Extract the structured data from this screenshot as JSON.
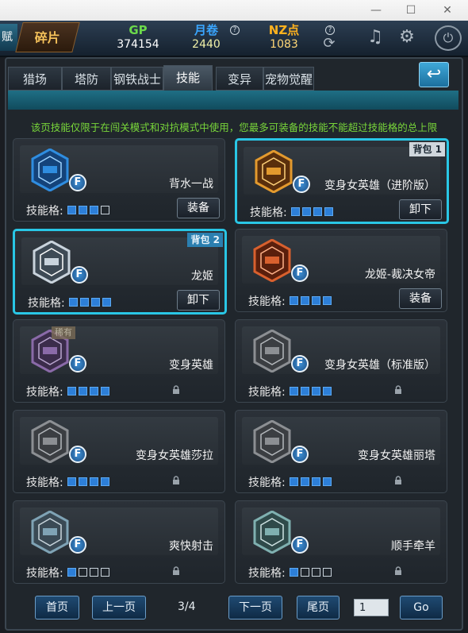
{
  "window": {
    "minimize": "—",
    "maximize": "☐",
    "close": "✕"
  },
  "topbar": {
    "left_cap": "赋",
    "fragments_tab": "碎片",
    "gp": {
      "label": "GP",
      "value": "374154"
    },
    "yuejuan": {
      "label": "月卷",
      "value": "2440"
    },
    "nz": {
      "label": "NZ点",
      "value": "1083"
    },
    "colors": {
      "gp": "#6bd94b",
      "yuejuan": "#3aa6ff",
      "nz": "#ffb21e"
    }
  },
  "tabs": [
    {
      "label": "猎场"
    },
    {
      "label": "塔防"
    },
    {
      "label": "钢铁战士"
    },
    {
      "label": "技能",
      "active": true
    },
    {
      "label": "变异"
    },
    {
      "label": "宠物觉醒"
    }
  ],
  "notice": "该页技能仅限于在闯关模式和对抗模式中使用，您最多可装备的技能不能超过技能格的总上限",
  "slot_label": "技能格:",
  "skills": [
    {
      "name": "背水一战",
      "badge": "F",
      "slots_total": 4,
      "slots_filled": 3,
      "action": "装备",
      "selected": false,
      "bag_tag": "",
      "locked": false,
      "icon": "shield-blue-icon"
    },
    {
      "name": "变身女英雄（进阶版）",
      "badge": "F",
      "slots_total": 4,
      "slots_filled": 4,
      "action": "卸下",
      "selected": true,
      "bag_tag": "背包 1",
      "locked": false,
      "icon": "hero-gold-icon"
    },
    {
      "name": "龙姬",
      "badge": "F",
      "slots_total": 4,
      "slots_filled": 4,
      "action": "卸下",
      "selected": true,
      "bag_tag": "背包 2",
      "locked": false,
      "icon": "hero-silver-icon"
    },
    {
      "name": "龙姬-裁决女帝",
      "badge": "F",
      "slots_total": 4,
      "slots_filled": 4,
      "action": "装备",
      "selected": false,
      "bag_tag": "",
      "locked": false,
      "icon": "hero-red-icon"
    },
    {
      "name": "变身英雄",
      "badge": "F",
      "slots_total": 4,
      "slots_filled": 4,
      "action": "",
      "selected": false,
      "bag_tag": "",
      "locked": true,
      "icon": "hero-purple-icon",
      "rare_tag": "稀有"
    },
    {
      "name": "变身女英雄（标准版）",
      "badge": "F",
      "slots_total": 4,
      "slots_filled": 4,
      "action": "",
      "selected": false,
      "bag_tag": "",
      "locked": true,
      "icon": "hero-grey-icon"
    },
    {
      "name": "变身女英雄莎拉",
      "badge": "F",
      "slots_total": 4,
      "slots_filled": 4,
      "action": "",
      "selected": false,
      "bag_tag": "",
      "locked": true,
      "icon": "hero-grey-icon"
    },
    {
      "name": "变身女英雄丽塔",
      "badge": "F",
      "slots_total": 4,
      "slots_filled": 4,
      "action": "",
      "selected": false,
      "bag_tag": "",
      "locked": true,
      "icon": "hero-grey-icon"
    },
    {
      "name": "爽快射击",
      "badge": "",
      "slots_total": 4,
      "slots_filled": 1,
      "action": "",
      "selected": false,
      "bag_tag": "",
      "locked": true,
      "icon": "bullets-icon"
    },
    {
      "name": "顺手牵羊",
      "badge": "",
      "slots_total": 4,
      "slots_filled": 1,
      "action": "",
      "selected": false,
      "bag_tag": "",
      "locked": true,
      "icon": "fist-icon"
    }
  ],
  "pager": {
    "first": "首页",
    "prev": "上一页",
    "current": "3/4",
    "next": "下一页",
    "last": "尾页",
    "input_value": "1",
    "go": "Go"
  }
}
